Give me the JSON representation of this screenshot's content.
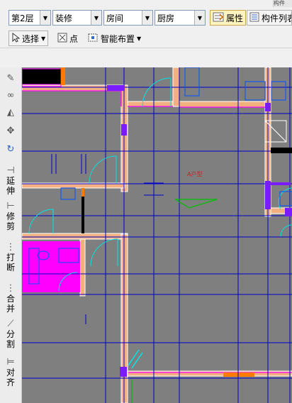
{
  "toolbar_top": {
    "floor": "第2层",
    "category": "装修",
    "type": "房间",
    "item": "厨房",
    "property_button": "属性",
    "component_list_button": "构件列表",
    "corner_text": "构件"
  },
  "toolbar_second": {
    "select_button": "选择",
    "point_button": "点",
    "smart_layout_button": "智能布置"
  },
  "left_tools": [
    {
      "icon": "brush-icon",
      "label": ""
    },
    {
      "icon": "link-icon",
      "label": ""
    },
    {
      "icon": "mirror-icon",
      "label": ""
    },
    {
      "icon": "move-icon",
      "label": ""
    },
    {
      "icon": "rotate-icon",
      "label": ""
    },
    {
      "icon": "extend-icon",
      "label": "延伸"
    },
    {
      "icon": "trim-icon",
      "label": "修剪"
    },
    {
      "icon": "break-icon",
      "label": "打断"
    },
    {
      "icon": "merge-icon",
      "label": "合并"
    },
    {
      "icon": "split-icon",
      "label": "分割"
    },
    {
      "icon": "align-icon",
      "label": "对齐"
    }
  ],
  "canvas": {
    "room_label": "A户型",
    "colors": {
      "background": "#7f7f7f",
      "axis_line": "#0000c8",
      "wall_fill": "#f2b080",
      "wall_edge": "#ffffff",
      "room_magenta": "#ff00ff",
      "column_purple": "#7a1cff",
      "door_cyan": "#00e5e5",
      "orange_beam": "#ff7a00",
      "green_arrow": "#00c000"
    }
  }
}
